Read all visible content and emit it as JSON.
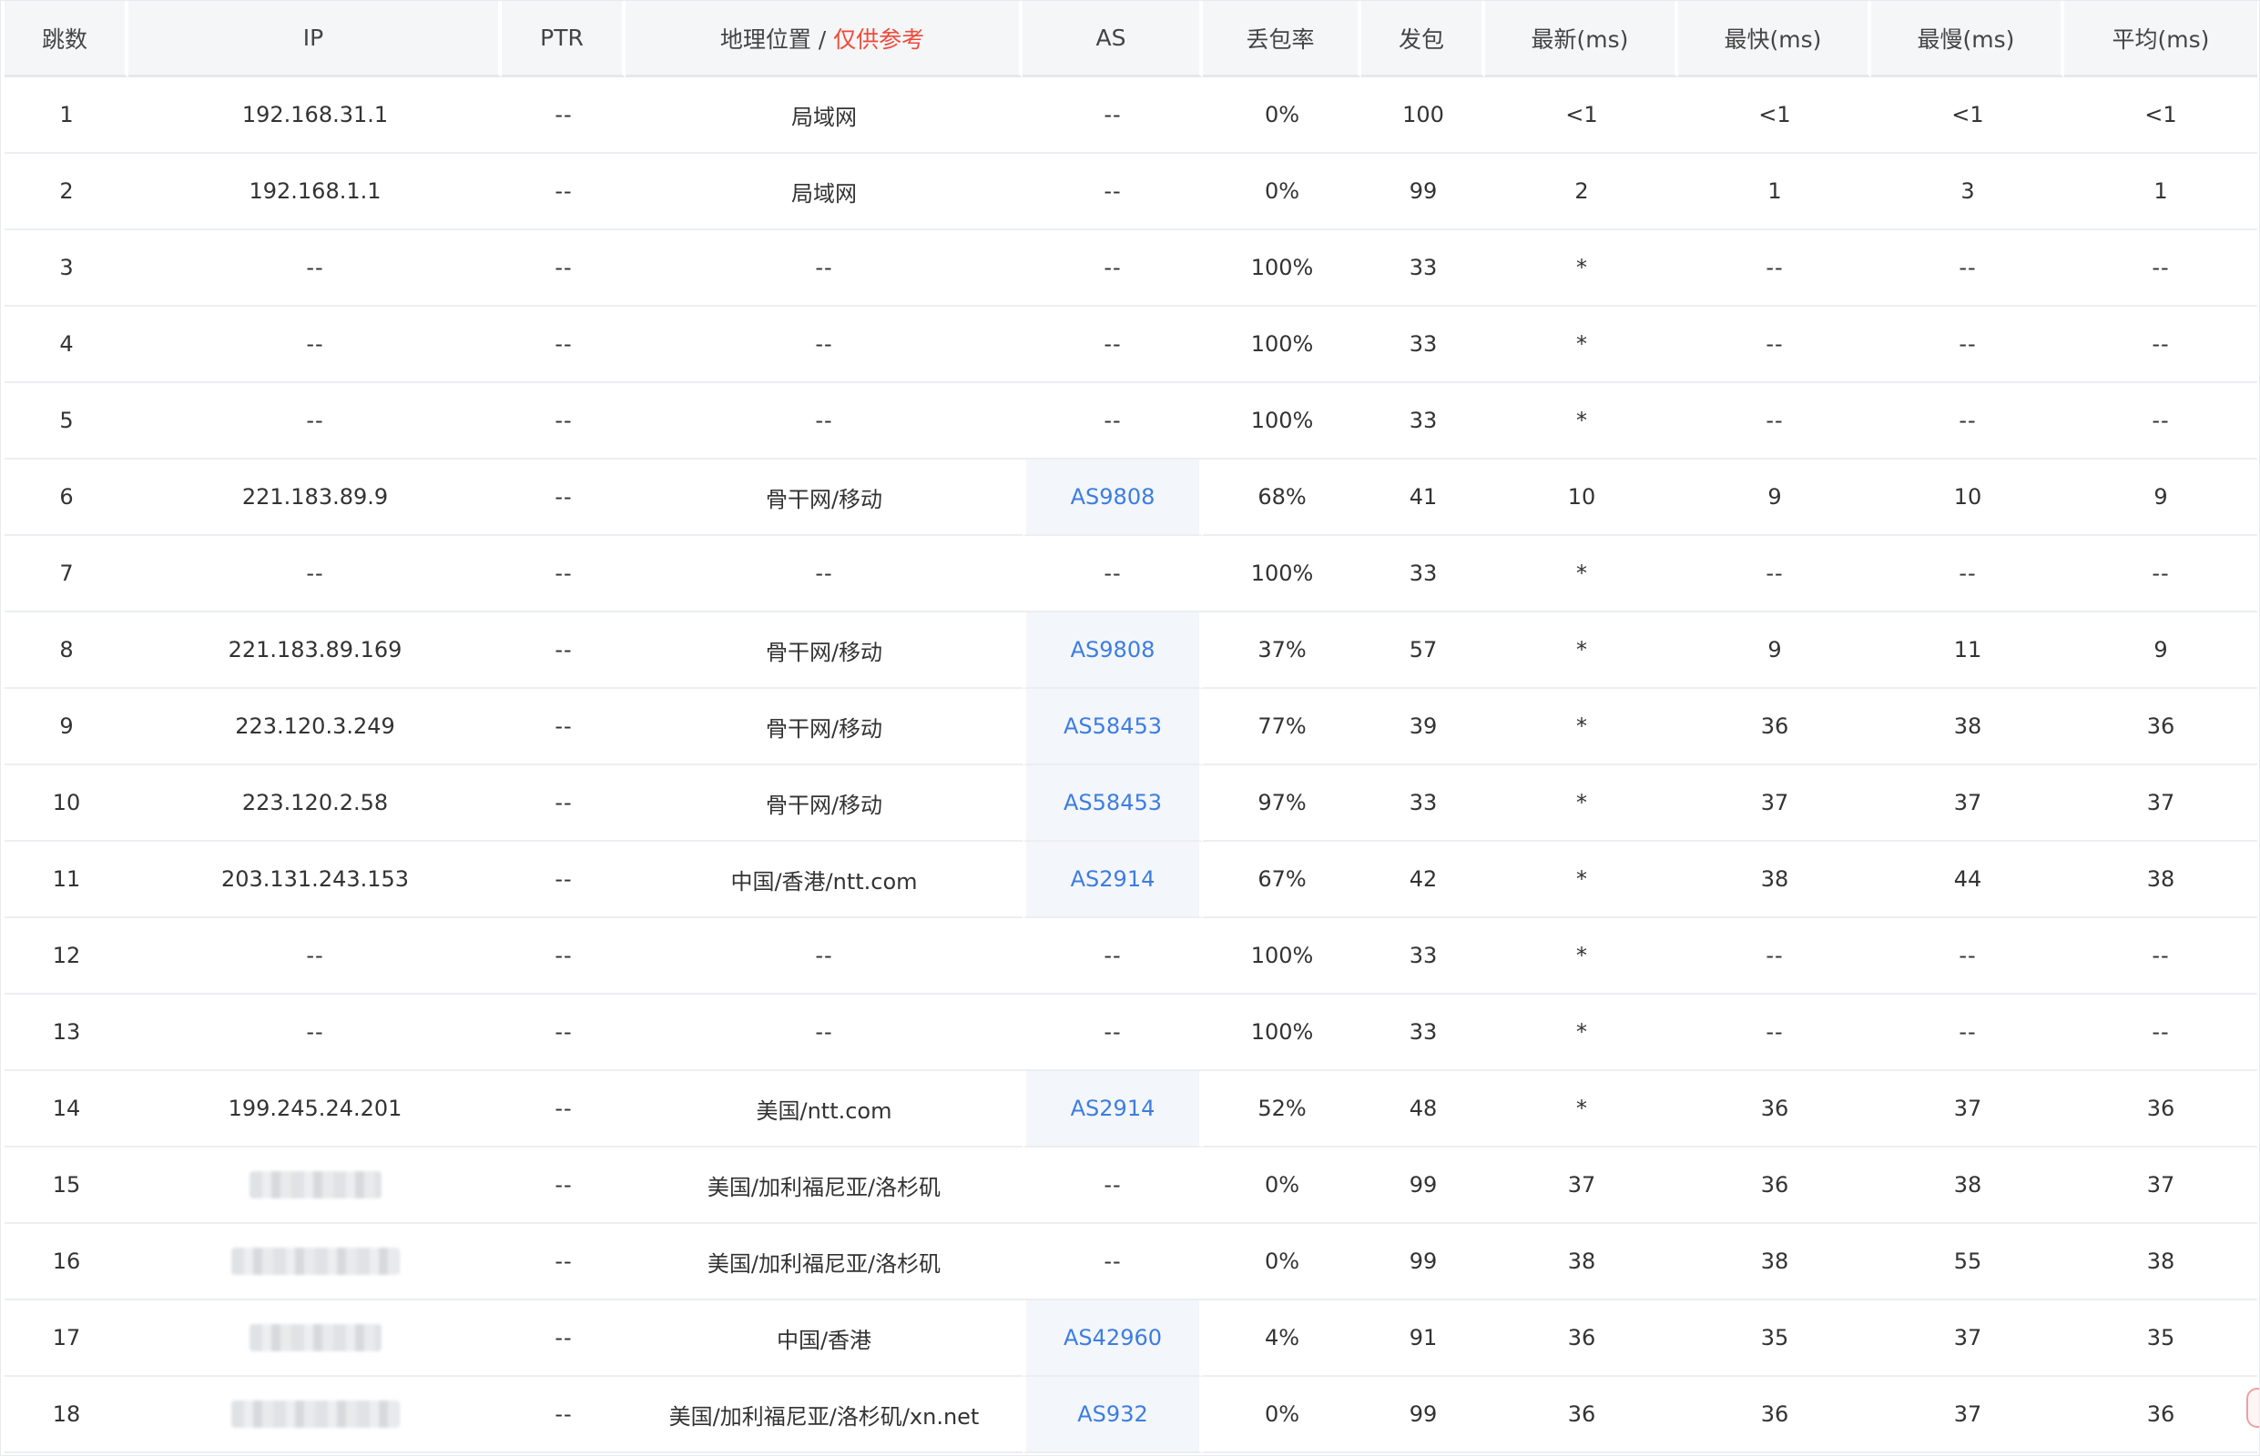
{
  "headers": {
    "hop": "跳数",
    "ip": "IP",
    "ptr": "PTR",
    "geo_main": "地理位置",
    "geo_sep": "/",
    "geo_note": "仅供参考",
    "as": "AS",
    "loss": "丢包率",
    "sent": "发包",
    "last": "最新(ms)",
    "best": "最快(ms)",
    "worst": "最慢(ms)",
    "avg": "平均(ms)"
  },
  "rows": [
    {
      "hop": "1",
      "ip": "192.168.31.1",
      "ptr": "--",
      "geo": "局域网",
      "as": "--",
      "loss": "0%",
      "sent": "100",
      "last": "<1",
      "best": "<1",
      "worst": "<1",
      "avg": "<1"
    },
    {
      "hop": "2",
      "ip": "192.168.1.1",
      "ptr": "--",
      "geo": "局域网",
      "as": "--",
      "loss": "0%",
      "sent": "99",
      "last": "2",
      "best": "1",
      "worst": "3",
      "avg": "1"
    },
    {
      "hop": "3",
      "ip": "--",
      "ptr": "--",
      "geo": "--",
      "as": "--",
      "loss": "100%",
      "sent": "33",
      "last": "*",
      "best": "--",
      "worst": "--",
      "avg": "--"
    },
    {
      "hop": "4",
      "ip": "--",
      "ptr": "--",
      "geo": "--",
      "as": "--",
      "loss": "100%",
      "sent": "33",
      "last": "*",
      "best": "--",
      "worst": "--",
      "avg": "--"
    },
    {
      "hop": "5",
      "ip": "--",
      "ptr": "--",
      "geo": "--",
      "as": "--",
      "loss": "100%",
      "sent": "33",
      "last": "*",
      "best": "--",
      "worst": "--",
      "avg": "--"
    },
    {
      "hop": "6",
      "ip": "221.183.89.9",
      "ptr": "--",
      "geo": "骨干网/移动",
      "as": "AS9808",
      "loss": "68%",
      "sent": "41",
      "last": "10",
      "best": "9",
      "worst": "10",
      "avg": "9"
    },
    {
      "hop": "7",
      "ip": "--",
      "ptr": "--",
      "geo": "--",
      "as": "--",
      "loss": "100%",
      "sent": "33",
      "last": "*",
      "best": "--",
      "worst": "--",
      "avg": "--"
    },
    {
      "hop": "8",
      "ip": "221.183.89.169",
      "ptr": "--",
      "geo": "骨干网/移动",
      "as": "AS9808",
      "loss": "37%",
      "sent": "57",
      "last": "*",
      "best": "9",
      "worst": "11",
      "avg": "9"
    },
    {
      "hop": "9",
      "ip": "223.120.3.249",
      "ptr": "--",
      "geo": "骨干网/移动",
      "as": "AS58453",
      "loss": "77%",
      "sent": "39",
      "last": "*",
      "best": "36",
      "worst": "38",
      "avg": "36"
    },
    {
      "hop": "10",
      "ip": "223.120.2.58",
      "ptr": "--",
      "geo": "骨干网/移动",
      "as": "AS58453",
      "loss": "97%",
      "sent": "33",
      "last": "*",
      "best": "37",
      "worst": "37",
      "avg": "37"
    },
    {
      "hop": "11",
      "ip": "203.131.243.153",
      "ptr": "--",
      "geo": "中国/香港/ntt.com",
      "as": "AS2914",
      "loss": "67%",
      "sent": "42",
      "last": "*",
      "best": "38",
      "worst": "44",
      "avg": "38"
    },
    {
      "hop": "12",
      "ip": "--",
      "ptr": "--",
      "geo": "--",
      "as": "--",
      "loss": "100%",
      "sent": "33",
      "last": "*",
      "best": "--",
      "worst": "--",
      "avg": "--"
    },
    {
      "hop": "13",
      "ip": "--",
      "ptr": "--",
      "geo": "--",
      "as": "--",
      "loss": "100%",
      "sent": "33",
      "last": "*",
      "best": "--",
      "worst": "--",
      "avg": "--"
    },
    {
      "hop": "14",
      "ip": "199.245.24.201",
      "ptr": "--",
      "geo": "美国/ntt.com",
      "as": "AS2914",
      "loss": "52%",
      "sent": "48",
      "last": "*",
      "best": "36",
      "worst": "37",
      "avg": "36"
    },
    {
      "hop": "15",
      "ip": "",
      "ip_blur_w": 145,
      "ptr": "--",
      "geo": "美国/加利福尼亚/洛杉矶",
      "as": "--",
      "loss": "0%",
      "sent": "99",
      "last": "37",
      "best": "36",
      "worst": "38",
      "avg": "37"
    },
    {
      "hop": "16",
      "ip": "",
      "ip_blur_w": 185,
      "ptr": "--",
      "geo": "美国/加利福尼亚/洛杉矶",
      "as": "--",
      "loss": "0%",
      "sent": "99",
      "last": "38",
      "best": "38",
      "worst": "55",
      "avg": "38"
    },
    {
      "hop": "17",
      "ip": "",
      "ip_blur_w": 145,
      "ptr": "--",
      "geo": "中国/香港",
      "as": "AS42960",
      "loss": "4%",
      "sent": "91",
      "last": "36",
      "best": "35",
      "worst": "37",
      "avg": "35"
    },
    {
      "hop": "18",
      "ip": "",
      "ip_blur_w": 185,
      "ptr": "--",
      "geo": "美国/加利福尼亚/洛杉矶/xn.net",
      "as": "AS932",
      "loss": "0%",
      "sent": "99",
      "last": "36",
      "best": "36",
      "worst": "37",
      "avg": "36"
    }
  ],
  "colors": {
    "as_link": "#3d7de0",
    "geo_note": "#f04a3a",
    "header_bg": "#f5f6f8",
    "as_cell_bg": "#f3f6fa"
  }
}
